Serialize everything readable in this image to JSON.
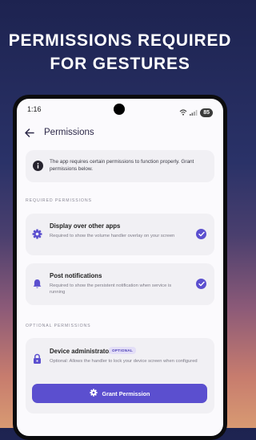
{
  "headline": {
    "line1": "PERMISSIONS REQUIRED",
    "line2": "FOR GESTURES"
  },
  "statusbar": {
    "time": "1:16",
    "battery": "85",
    "icons": [
      "wifi-icon",
      "signal-icon",
      "battery-icon"
    ]
  },
  "appbar": {
    "title": "Permissions",
    "back_icon": "arrow-left-icon"
  },
  "info": {
    "icon": "info-icon",
    "text": "The app requires certain permissions to function properly. Grant permissions below."
  },
  "sections": {
    "required": "REQUIRED PERMISSIONS",
    "optional": "OPTIONAL PERMISSIONS"
  },
  "required_permissions": [
    {
      "icon": "gear-icon",
      "title": "Display over other apps",
      "description": "Required to show the volume handler overlay on your screen",
      "granted": true
    },
    {
      "icon": "bell-icon",
      "title": "Post notifications",
      "description": "Required to show the persistent notification when service is running",
      "granted": true
    }
  ],
  "optional_permissions": [
    {
      "icon": "lock-icon",
      "title": "Device administrator",
      "badge": "OPTIONAL",
      "description": "Optional: Allows the handler to lock your device screen when configured",
      "button_label": "Grant Permission",
      "button_icon": "gear-icon"
    }
  ],
  "colors": {
    "accent": "#5b4fcf",
    "card": "#f1f0f4",
    "screen_bg": "#fbfafd",
    "badge_bg": "#e3def7"
  }
}
